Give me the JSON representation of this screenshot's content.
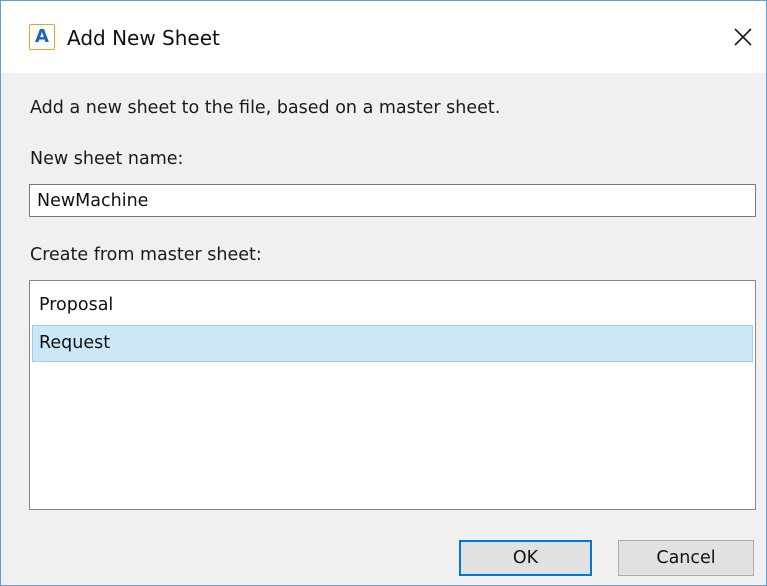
{
  "window": {
    "title": "Add New Sheet",
    "app_icon_letter": "A",
    "close_icon": "close-icon"
  },
  "dialog": {
    "description": "Add a new sheet to the file, based on a master sheet.",
    "name_label": "New sheet name:",
    "name_value": "NewMachine",
    "master_label": "Create from master sheet:",
    "master_sheets": [
      {
        "label": "Proposal",
        "selected": false
      },
      {
        "label": "Request",
        "selected": true
      }
    ]
  },
  "buttons": {
    "ok_label": "OK",
    "cancel_label": "Cancel"
  },
  "colors": {
    "window_border": "#5f9fd6",
    "selection_fill": "#cce8f7",
    "selection_border": "#99d1ef",
    "default_button_border": "#0078d7",
    "icon_accent": "#f0a22b",
    "icon_letter": "#2160c4"
  }
}
